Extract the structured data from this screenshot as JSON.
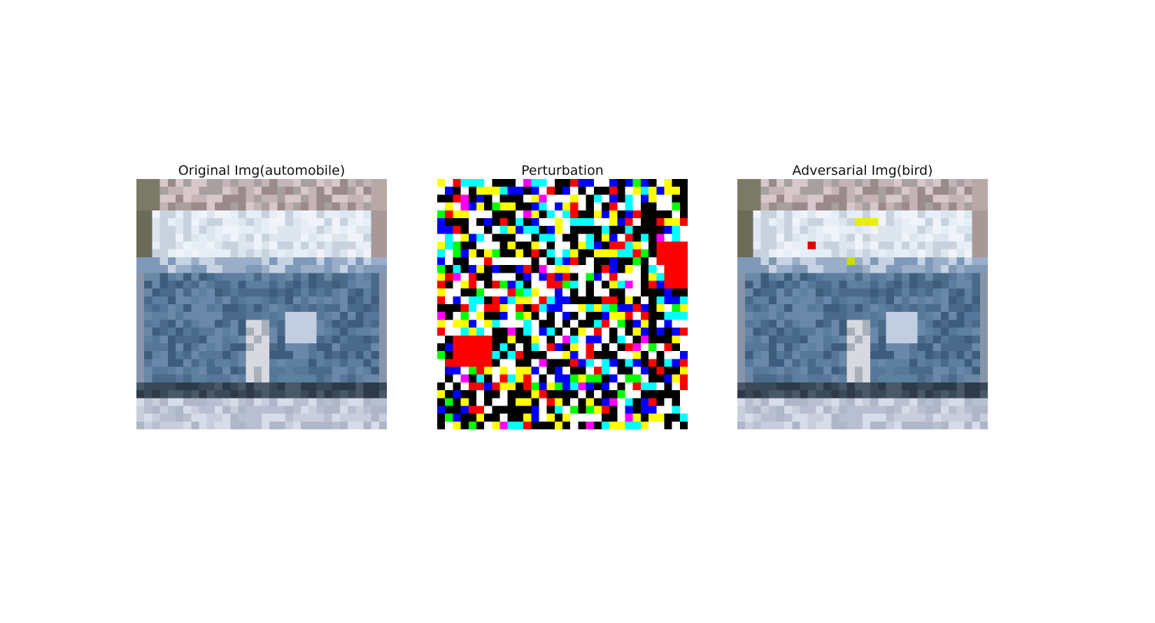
{
  "figure": {
    "panels": [
      {
        "title": "Original Img(automobile)"
      },
      {
        "title": "Perturbation"
      },
      {
        "title": "Adversarial Img(bird)"
      }
    ]
  },
  "colors": {
    "perturbation_palette": [
      "#000000",
      "#ffffff",
      "#ffff00",
      "#00ffff",
      "#0000ff",
      "#ff0000",
      "#00ff00",
      "#ff00ff"
    ],
    "car_body": "#4f6f8f",
    "sky": "#e8eef6",
    "adv_red": "#e00000",
    "adv_yellow": "#e8f000",
    "adv_yellowgreen": "#c8e000"
  }
}
